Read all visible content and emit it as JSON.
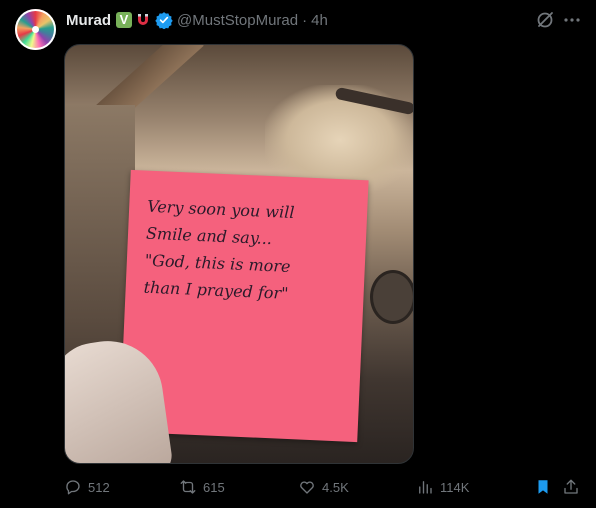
{
  "author": {
    "name": "Murad",
    "handle": "@MustStopMurad",
    "separator": "·",
    "time": "4h"
  },
  "badges": {
    "emoji_box_text": "V",
    "emoji_magnet": "magnet-emoji",
    "verified": "verified-badge-icon"
  },
  "media": {
    "note_lines": [
      "Very soon you will",
      "Smile and say...",
      "\"God, this is more",
      "than I prayed for\""
    ]
  },
  "actions": {
    "replies": "512",
    "reposts": "615",
    "likes": "4.5K",
    "views": "114K"
  },
  "colors": {
    "background": "#000000",
    "text": "#e7e9ea",
    "muted": "#71767b",
    "verified": "#1d9bf0",
    "bookmark": "#1d9bf0",
    "note": "#f5617d"
  }
}
